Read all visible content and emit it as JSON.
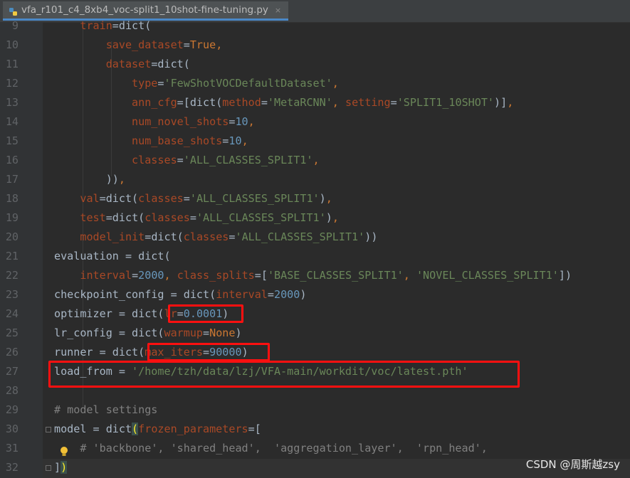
{
  "tab": {
    "file_name": "vfa_r101_c4_8xb4_voc-split1_10shot-fine-tuning.py",
    "close_glyph": "×",
    "icon": "python-file-icon"
  },
  "editor": {
    "lines": [
      {
        "number": "9",
        "segments": [
          [
            "    ",
            ""
          ],
          [
            "train",
            "param"
          ],
          [
            "=dict(",
            ""
          ]
        ]
      },
      {
        "number": "10",
        "segments": [
          [
            "        ",
            ""
          ],
          [
            "save_dataset",
            "param"
          ],
          [
            "=",
            ""
          ],
          [
            "True",
            "kw"
          ],
          [
            ",",
            "kw"
          ]
        ]
      },
      {
        "number": "11",
        "segments": [
          [
            "        ",
            ""
          ],
          [
            "dataset",
            "param"
          ],
          [
            "=dict(",
            ""
          ]
        ]
      },
      {
        "number": "12",
        "segments": [
          [
            "            ",
            ""
          ],
          [
            "type",
            "param"
          ],
          [
            "=",
            ""
          ],
          [
            "'FewShotVOCDefaultDataset'",
            "str"
          ],
          [
            ",",
            "kw"
          ]
        ]
      },
      {
        "number": "13",
        "segments": [
          [
            "            ",
            ""
          ],
          [
            "ann_cfg",
            "param"
          ],
          [
            "=[dict(",
            ""
          ],
          [
            "method",
            "param"
          ],
          [
            "=",
            ""
          ],
          [
            "'MetaRCNN'",
            "str"
          ],
          [
            ", ",
            "kw"
          ],
          [
            "setting",
            "param"
          ],
          [
            "=",
            ""
          ],
          [
            "'SPLIT1_10SHOT'",
            "str"
          ],
          [
            ")]",
            ""
          ],
          [
            ",",
            "kw"
          ]
        ]
      },
      {
        "number": "14",
        "segments": [
          [
            "            ",
            ""
          ],
          [
            "num_novel_shots",
            "param"
          ],
          [
            "=",
            ""
          ],
          [
            "10",
            "num"
          ],
          [
            ",",
            "kw"
          ]
        ]
      },
      {
        "number": "15",
        "segments": [
          [
            "            ",
            ""
          ],
          [
            "num_base_shots",
            "param"
          ],
          [
            "=",
            ""
          ],
          [
            "10",
            "num"
          ],
          [
            ",",
            "kw"
          ]
        ]
      },
      {
        "number": "16",
        "segments": [
          [
            "            ",
            ""
          ],
          [
            "classes",
            "param"
          ],
          [
            "=",
            ""
          ],
          [
            "'ALL_CLASSES_SPLIT1'",
            "str"
          ],
          [
            ",",
            "kw"
          ]
        ]
      },
      {
        "number": "17",
        "segments": [
          [
            "        ",
            ""
          ],
          [
            "))",
            ""
          ],
          [
            ",",
            "kw"
          ]
        ]
      },
      {
        "number": "18",
        "segments": [
          [
            "    ",
            ""
          ],
          [
            "val",
            "param"
          ],
          [
            "=dict(",
            ""
          ],
          [
            "classes",
            "param"
          ],
          [
            "=",
            ""
          ],
          [
            "'ALL_CLASSES_SPLIT1'",
            "str"
          ],
          [
            ")",
            ""
          ],
          [
            ",",
            "kw"
          ]
        ]
      },
      {
        "number": "19",
        "segments": [
          [
            "    ",
            ""
          ],
          [
            "test",
            "param"
          ],
          [
            "=dict(",
            ""
          ],
          [
            "classes",
            "param"
          ],
          [
            "=",
            ""
          ],
          [
            "'ALL_CLASSES_SPLIT1'",
            "str"
          ],
          [
            ")",
            ""
          ],
          [
            ",",
            "kw"
          ]
        ]
      },
      {
        "number": "20",
        "segments": [
          [
            "    ",
            ""
          ],
          [
            "model_init",
            "param"
          ],
          [
            "=dict(",
            ""
          ],
          [
            "classes",
            "param"
          ],
          [
            "=",
            ""
          ],
          [
            "'ALL_CLASSES_SPLIT1'",
            "str"
          ],
          [
            "))",
            ""
          ]
        ]
      },
      {
        "number": "21",
        "segments": [
          [
            "evaluation = dict(",
            ""
          ]
        ]
      },
      {
        "number": "22",
        "segments": [
          [
            "    ",
            ""
          ],
          [
            "interval",
            "param"
          ],
          [
            "=",
            ""
          ],
          [
            "2000",
            "num"
          ],
          [
            ", ",
            "kw"
          ],
          [
            "class_splits",
            "param"
          ],
          [
            "=[",
            ""
          ],
          [
            "'BASE_CLASSES_SPLIT1'",
            "str"
          ],
          [
            ", ",
            "kw"
          ],
          [
            "'NOVEL_CLASSES_SPLIT1'",
            "str"
          ],
          [
            "])",
            ""
          ]
        ]
      },
      {
        "number": "23",
        "segments": [
          [
            "checkpoint_config = dict(",
            ""
          ],
          [
            "interval",
            "param"
          ],
          [
            "=",
            ""
          ],
          [
            "2000",
            "num"
          ],
          [
            ")",
            ""
          ]
        ]
      },
      {
        "number": "24",
        "segments": [
          [
            "optimizer = dict(",
            ""
          ],
          [
            "lr",
            "param"
          ],
          [
            "=",
            ""
          ],
          [
            "0.0001",
            "num"
          ],
          [
            ")",
            ""
          ]
        ]
      },
      {
        "number": "25",
        "segments": [
          [
            "lr_config = dict(",
            ""
          ],
          [
            "warmup",
            "param"
          ],
          [
            "=",
            ""
          ],
          [
            "None",
            "kw"
          ],
          [
            ")",
            ""
          ]
        ]
      },
      {
        "number": "26",
        "segments": [
          [
            "runner = dict(",
            ""
          ],
          [
            "max_iters",
            "param"
          ],
          [
            "=",
            ""
          ],
          [
            "90000",
            "num"
          ],
          [
            ")",
            ""
          ]
        ]
      },
      {
        "number": "27",
        "segments": [
          [
            "load_from = ",
            ""
          ],
          [
            "'/home/tzh/data/lzj/VFA-main/workdit/voc/latest.pth'",
            "str"
          ]
        ]
      },
      {
        "number": "28",
        "segments": []
      },
      {
        "number": "29",
        "segments": [
          [
            "# model settings",
            "cmt"
          ]
        ]
      },
      {
        "number": "30",
        "segments": [
          [
            "model = dict",
            ""
          ],
          [
            "(",
            "bracket-hl"
          ],
          [
            "frozen_parameters",
            "param"
          ],
          [
            "=[",
            ""
          ]
        ]
      },
      {
        "number": "31",
        "segments": [
          [
            "    ",
            ""
          ],
          [
            "# 'backbone', 'shared_head',  'aggregation_layer',  'rpn_head',",
            "cmt"
          ]
        ]
      },
      {
        "number": "32",
        "segments": [
          [
            "]",
            ""
          ],
          [
            ")",
            "bracket-hl"
          ]
        ]
      }
    ]
  },
  "watermark": "CSDN @周斯越zsy",
  "colors": {
    "background": "#2b2b2b",
    "highlight_box": "#ff1010",
    "string": "#6a8759",
    "keyword": "#cc7832",
    "number": "#6897bb",
    "param": "#aa4926"
  }
}
